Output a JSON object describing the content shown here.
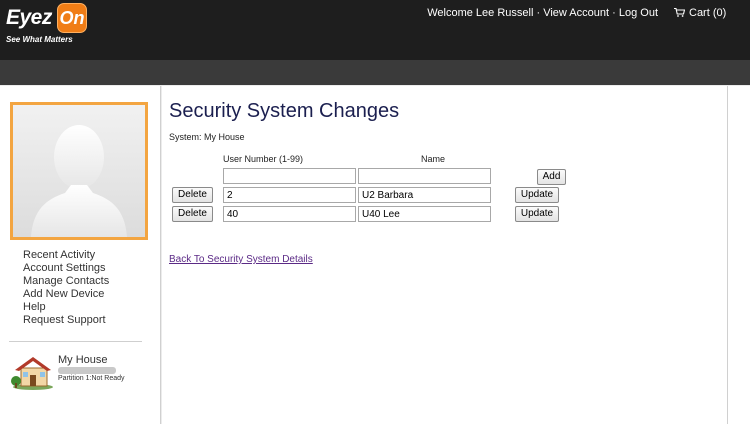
{
  "header": {
    "logo_main": "Eyez",
    "logo_badge": "On",
    "logo_tagline": "See What Matters",
    "welcome": "Welcome Lee Russell",
    "separator": "·",
    "view_account": "View Account",
    "log_out": "Log Out",
    "cart_label": "Cart (0)",
    "cart_icon": "shopping-cart-icon"
  },
  "sidebar": {
    "menu": [
      "Recent Activity",
      "Account Settings",
      "Manage Contacts",
      "Add New Device",
      "Help",
      "Request Support"
    ],
    "house_name": "My House",
    "house_status": "Partition 1:Not Ready",
    "house_icon": "house-icon",
    "avatar_icon": "user-silhouette-icon"
  },
  "main": {
    "title": "Security System Changes",
    "system_label": "System: My House",
    "column_user_number": "User Number (1-99)",
    "column_name": "Name",
    "new_row": {
      "number": "",
      "name": "",
      "add_label": "Add"
    },
    "users": [
      {
        "delete_label": "Delete",
        "number": "2",
        "name": "U2 Barbara",
        "update_label": "Update"
      },
      {
        "delete_label": "Delete",
        "number": "40",
        "name": "U40 Lee",
        "update_label": "Update"
      }
    ],
    "back_link": "Back To Security System Details"
  },
  "colors": {
    "header_bg": "#1e1e1e",
    "accent_orange": "#f07d16",
    "title_navy": "#1b1f4f",
    "link_purple": "#5b2a86"
  }
}
